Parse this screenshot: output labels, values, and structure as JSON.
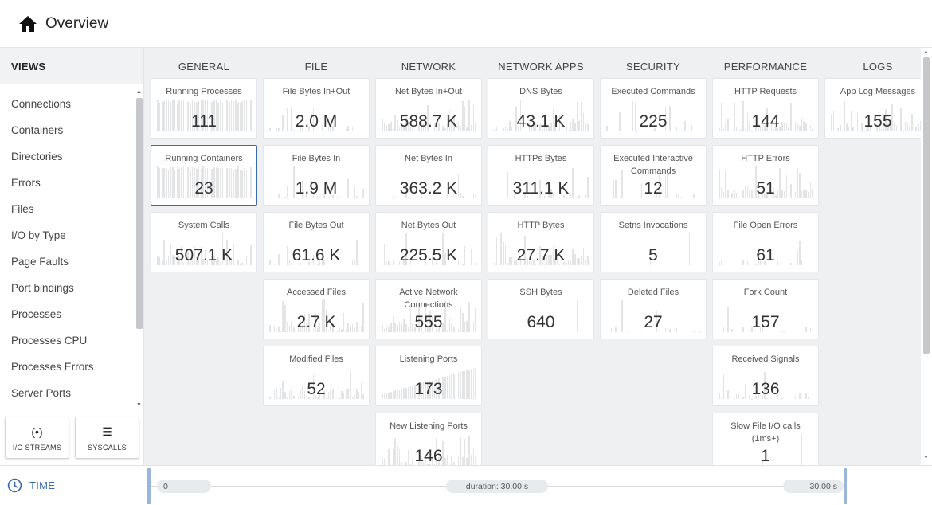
{
  "header": {
    "title": "Overview"
  },
  "sidebar": {
    "heading": "VIEWS",
    "items": [
      "Connections",
      "Containers",
      "Directories",
      "Errors",
      "Files",
      "I/O by Type",
      "Page Faults",
      "Port bindings",
      "Processes",
      "Processes CPU",
      "Processes Errors",
      "Server Ports"
    ],
    "buttons": [
      {
        "label": "I/O STREAMS",
        "icon": "broadcast-icon"
      },
      {
        "label": "SYSCALLS",
        "icon": "list-icon"
      }
    ]
  },
  "columns": [
    {
      "title": "GENERAL",
      "tiles": [
        {
          "name": "Running Processes",
          "value": "111",
          "spark": "full"
        },
        {
          "name": "Running Containers",
          "value": "23",
          "spark": "full",
          "selected": true
        },
        {
          "name": "System Calls",
          "value": "507.1 K",
          "spark": "dense"
        }
      ]
    },
    {
      "title": "FILE",
      "tiles": [
        {
          "name": "File Bytes In+Out",
          "value": "2.0 M",
          "spark": "sparse"
        },
        {
          "name": "File Bytes In",
          "value": "1.9 M",
          "spark": "sparse"
        },
        {
          "name": "File Bytes Out",
          "value": "61.6 K",
          "spark": "sparse"
        },
        {
          "name": "Accessed Files",
          "value": "2.7 K",
          "spark": "dense"
        },
        {
          "name": "Modified Files",
          "value": "52",
          "spark": "dense"
        }
      ]
    },
    {
      "title": "NETWORK",
      "tiles": [
        {
          "name": "Net Bytes In+Out",
          "value": "588.7 K",
          "spark": "dense"
        },
        {
          "name": "Net Bytes In",
          "value": "363.2 K",
          "spark": "sparse"
        },
        {
          "name": "Net Bytes Out",
          "value": "225.5 K",
          "spark": "sparse"
        },
        {
          "name": "Active Network Connections",
          "value": "555",
          "spark": "dense"
        },
        {
          "name": "Listening Ports",
          "value": "173",
          "spark": "ramp"
        },
        {
          "name": "New Listening Ports",
          "value": "146",
          "spark": "dense"
        }
      ]
    },
    {
      "title": "NETWORK APPS",
      "tiles": [
        {
          "name": "DNS Bytes",
          "value": "43.1 K",
          "spark": "dense"
        },
        {
          "name": "HTTPs Bytes",
          "value": "311.1 K",
          "spark": "sparse"
        },
        {
          "name": "HTTP Bytes",
          "value": "27.7 K",
          "spark": "dense"
        },
        {
          "name": "SSH Bytes",
          "value": "640",
          "spark": "single"
        }
      ]
    },
    {
      "title": "SECURITY",
      "tiles": [
        {
          "name": "Executed Commands",
          "value": "225",
          "spark": "sparse"
        },
        {
          "name": "Executed Interactive Commands",
          "value": "12",
          "spark": "sparse"
        },
        {
          "name": "Setns Invocations",
          "value": "5",
          "spark": "single"
        },
        {
          "name": "Deleted Files",
          "value": "27",
          "spark": "sparse"
        }
      ]
    },
    {
      "title": "PERFORMANCE",
      "tiles": [
        {
          "name": "HTTP Requests",
          "value": "144",
          "spark": "dense"
        },
        {
          "name": "HTTP Errors",
          "value": "51",
          "spark": "dense"
        },
        {
          "name": "File Open Errors",
          "value": "61",
          "spark": "sparse"
        },
        {
          "name": "Fork Count",
          "value": "157",
          "spark": "sparse"
        },
        {
          "name": "Received Signals",
          "value": "136",
          "spark": "sparse"
        },
        {
          "name": "Slow File I/O calls (1ms+)",
          "value": "1",
          "spark": "single"
        }
      ]
    },
    {
      "title": "LOGS",
      "tiles": [
        {
          "name": "App Log Messages",
          "value": "155",
          "spark": "dense"
        }
      ]
    }
  ],
  "time": {
    "label": "TIME",
    "start": "0",
    "duration": "duration: 30.00 s",
    "end": "30.00 s"
  }
}
